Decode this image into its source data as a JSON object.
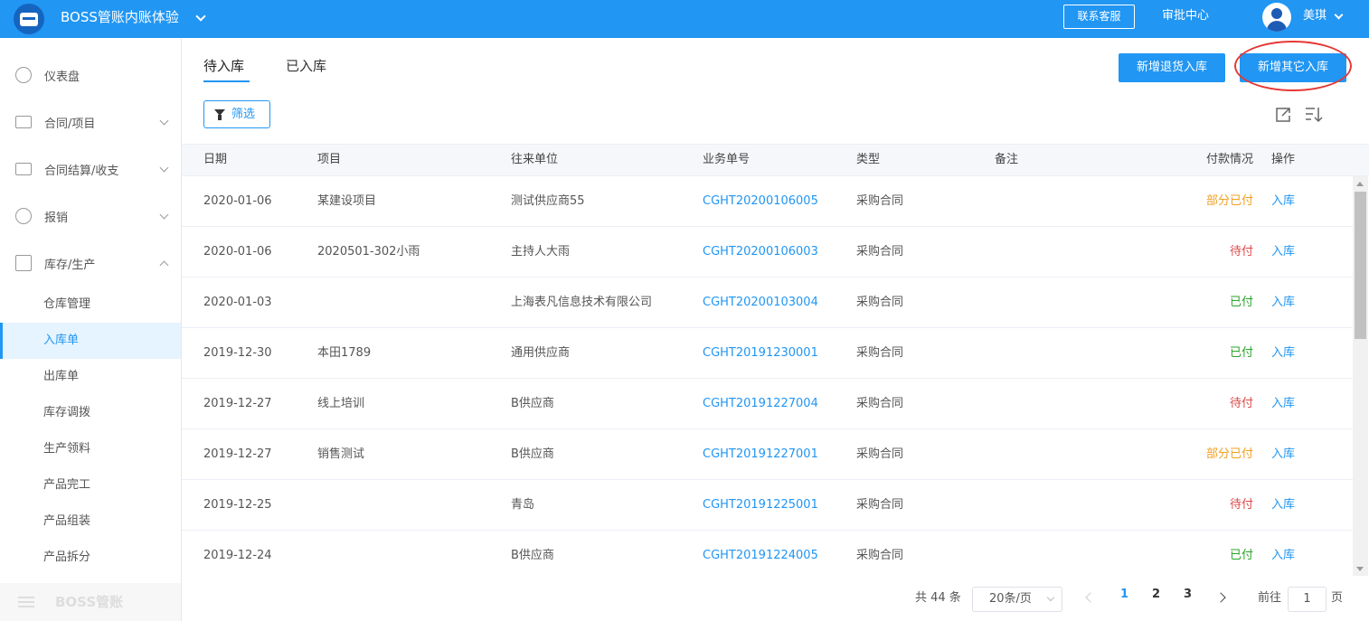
{
  "header": {
    "org_name": "BOSS管账内账体验",
    "contact_label": "联系客服",
    "approval_label": "审批中心",
    "user_name": "美琪"
  },
  "sidebar": {
    "items": [
      {
        "label": "仪表盘",
        "icon": "dashboard-icon"
      },
      {
        "label": "合同/项目",
        "icon": "folder-icon"
      },
      {
        "label": "合同结算/收支",
        "icon": "settlement-icon"
      },
      {
        "label": "报销",
        "icon": "yuan-icon"
      },
      {
        "label": "库存/生产",
        "icon": "box-icon"
      }
    ],
    "subitems": [
      {
        "label": "仓库管理"
      },
      {
        "label": "入库单"
      },
      {
        "label": "出库单"
      },
      {
        "label": "库存调拨"
      },
      {
        "label": "生产领料"
      },
      {
        "label": "产品完工"
      },
      {
        "label": "产品组装"
      },
      {
        "label": "产品拆分"
      }
    ],
    "collapse_label": "BOSS管账"
  },
  "main": {
    "tabs": [
      {
        "label": "待入库"
      },
      {
        "label": "已入库"
      }
    ],
    "btn_return": "新增退货入库",
    "btn_other": "新增其它入库",
    "filter_label": "筛选"
  },
  "table": {
    "headers": {
      "date": "日期",
      "project": "项目",
      "partner": "往来单位",
      "order_no": "业务单号",
      "type": "类型",
      "remark": "备注",
      "payment": "付款情况",
      "action": "操作"
    },
    "rows": [
      {
        "date": "2020-01-06",
        "project": "某建设项目",
        "partner": "测试供应商55",
        "order_no": "CGHT20200106005",
        "type": "采购合同",
        "remark": "",
        "payment": "部分已付",
        "action": "入库"
      },
      {
        "date": "2020-01-06",
        "project": "2020501-302小雨",
        "partner": "主持人大雨",
        "order_no": "CGHT20200106003",
        "type": "采购合同",
        "remark": "",
        "payment": "待付",
        "action": "入库"
      },
      {
        "date": "2020-01-03",
        "project": "",
        "partner": "上海表凡信息技术有限公司",
        "order_no": "CGHT20200103004",
        "type": "采购合同",
        "remark": "",
        "payment": "已付",
        "action": "入库"
      },
      {
        "date": "2019-12-30",
        "project": "本田1789",
        "partner": "通用供应商",
        "order_no": "CGHT20191230001",
        "type": "采购合同",
        "remark": "",
        "payment": "已付",
        "action": "入库"
      },
      {
        "date": "2019-12-27",
        "project": "线上培训",
        "partner": "B供应商",
        "order_no": "CGHT20191227004",
        "type": "采购合同",
        "remark": "",
        "payment": "待付",
        "action": "入库"
      },
      {
        "date": "2019-12-27",
        "project": "销售测试",
        "partner": "B供应商",
        "order_no": "CGHT20191227001",
        "type": "采购合同",
        "remark": "",
        "payment": "部分已付",
        "action": "入库"
      },
      {
        "date": "2019-12-25",
        "project": "",
        "partner": "青岛",
        "order_no": "CGHT20191225001",
        "type": "采购合同",
        "remark": "",
        "payment": "待付",
        "action": "入库"
      },
      {
        "date": "2019-12-24",
        "project": "",
        "partner": "B供应商",
        "order_no": "CGHT20191224005",
        "type": "采购合同",
        "remark": "",
        "payment": "已付",
        "action": "入库"
      }
    ]
  },
  "pagination": {
    "total": "共 44 条",
    "page_size": "20条/页",
    "pages": [
      "1",
      "2",
      "3"
    ],
    "goto_label": "前往",
    "goto_value": "1",
    "page_label": "页"
  },
  "colors": {
    "primary": "#2196f3",
    "partial": "#f0a020",
    "pending": "#e04848",
    "paid": "#2aa52a",
    "annotation": "#e53935"
  }
}
